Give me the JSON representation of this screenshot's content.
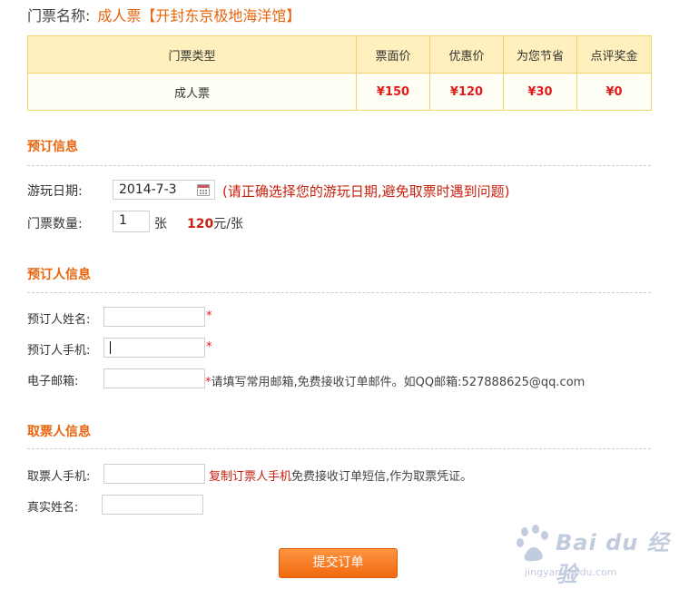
{
  "header": {
    "label": "门票名称:",
    "ticket_name": "成人票【开封东京极地海洋馆】"
  },
  "price_table": {
    "columns": [
      "门票类型",
      "票面价",
      "优惠价",
      "为您节省",
      "点评奖金"
    ],
    "rows": [
      [
        "成人票",
        "¥150",
        "¥120",
        "¥30",
        "¥0"
      ]
    ]
  },
  "booking_info": {
    "title": "预订信息",
    "date_label": "游玩日期:",
    "date_value": "2014-7-3",
    "date_hint": "(请正确选择您的游玩日期,避免取票时遇到问题)",
    "qty_label": "门票数量:",
    "qty_value": "1",
    "qty_unit": "张",
    "unit_price": "120",
    "unit_price_suffix": "元/张"
  },
  "booker_info": {
    "title": "预订人信息",
    "name_label": "预订人姓名:",
    "phone_label": "预订人手机:",
    "email_label": "电子邮箱:",
    "required_mark": "*",
    "email_hint": "请填写常用邮箱,免费接收订单邮件。如QQ邮箱:527888625@qq.com"
  },
  "pickup_info": {
    "title": "取票人信息",
    "phone_label": "取票人手机:",
    "copy_link": "复制订票人手机",
    "phone_hint": "免费接收订单短信,作为取票凭证。",
    "realname_label": "真实姓名:"
  },
  "submit_label": "提交订单",
  "watermark": {
    "brand": "Bai du 经验",
    "url": "jingyan.baidu.com"
  },
  "colors": {
    "accent_orange": "#e8650e",
    "price_red": "#e21b1b",
    "table_border": "#f0d36d",
    "table_header_bg": "#fff0bd"
  }
}
